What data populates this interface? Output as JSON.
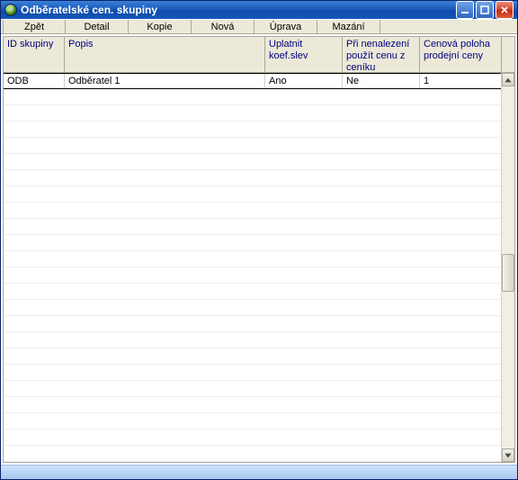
{
  "window": {
    "title": "Odběratelské cen. skupiny"
  },
  "toolbar": {
    "back": "Zpět",
    "detail": "Detail",
    "copy": "Kopie",
    "new": "Nová",
    "edit": "Úprava",
    "delete": "Mazání"
  },
  "columns": {
    "id": "ID skupiny",
    "desc": "Popis",
    "apply": "Uplatnit koef.slev",
    "fallback": "Při nenalezení použít cenu z ceníku",
    "pricepos": "Cenová poloha prodejní ceny"
  },
  "rows": [
    {
      "id": "ODB",
      "desc": "Odběratel 1",
      "apply": "Ano",
      "fallback": "Ne",
      "pricepos": "1"
    }
  ]
}
